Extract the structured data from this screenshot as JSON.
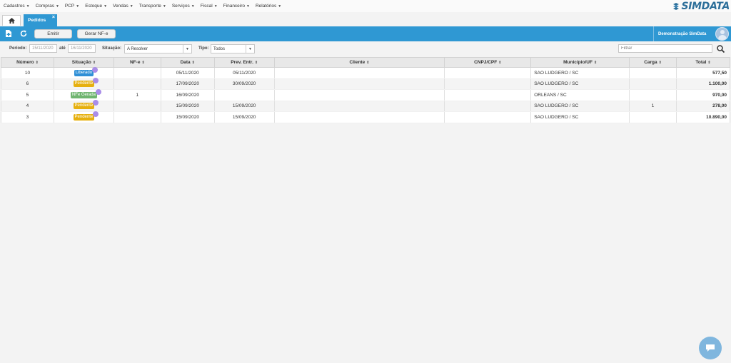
{
  "menu": [
    {
      "label": "Cadastros"
    },
    {
      "label": "Compras"
    },
    {
      "label": "PCP"
    },
    {
      "label": "Estoque"
    },
    {
      "label": "Vendas"
    },
    {
      "label": "Transporte"
    },
    {
      "label": "Serviços"
    },
    {
      "label": "Fiscal"
    },
    {
      "label": "Financeiro"
    },
    {
      "label": "Relatórios"
    }
  ],
  "logo_text": "SIMDATA",
  "tab": {
    "label": "Pedidos",
    "close": "×"
  },
  "toolbar": {
    "emitir": "Emitir",
    "gerar_nfe": "Gerar NF-e",
    "user": "Demonstração SimData"
  },
  "filters": {
    "periodo_label": "Período:",
    "date_from": "15/11/2020",
    "ate_label": "até",
    "date_to": "16/11/2020",
    "situacao_label": "Situação:",
    "situacao_value": "A Resolver",
    "tipo_label": "Tipo:",
    "tipo_value": "Todos",
    "filtrar_placeholder": "Filtrar"
  },
  "table": {
    "headers": [
      "Número",
      "Situação",
      "NF-e",
      "Data",
      "Prev. Entr.",
      "Cliente",
      "CNPJ/CPF",
      "Município/UF",
      "Carga",
      "Total"
    ],
    "rows": [
      {
        "numero": "10",
        "situacao": "Liberado",
        "badge_color": "#2f8fd6",
        "nfe": "",
        "data": "05/11/2020",
        "prev": "05/11/2020",
        "cliente": "",
        "cnpj": "",
        "municipio": "SAO LUDGERO / SC",
        "carga": "",
        "total": "577,50"
      },
      {
        "numero": "6",
        "situacao": "Pendente",
        "badge_color": "#e6b00f",
        "nfe": "",
        "data": "17/09/2020",
        "prev": "30/09/2020",
        "cliente": "",
        "cnpj": "",
        "municipio": "SAO LUDGERO / SC",
        "carga": "",
        "total": "1.100,00"
      },
      {
        "numero": "5",
        "situacao": "NFe Gerada",
        "badge_color": "#6fb56f",
        "nfe": "1",
        "data": "16/09/2020",
        "prev": "",
        "cliente": "",
        "cnpj": "",
        "municipio": "ORLEANS / SC",
        "carga": "",
        "total": "970,00"
      },
      {
        "numero": "4",
        "situacao": "Pendente",
        "badge_color": "#e6b00f",
        "nfe": "",
        "data": "15/09/2020",
        "prev": "15/09/2020",
        "cliente": "",
        "cnpj": "",
        "municipio": "SAO LUDGERO / SC",
        "carga": "1",
        "total": "278,00"
      },
      {
        "numero": "3",
        "situacao": "Pendente",
        "badge_color": "#e6b00f",
        "nfe": "",
        "data": "15/09/2020",
        "prev": "15/09/2020",
        "cliente": "",
        "cnpj": "",
        "municipio": "SAO LUDGERO / SC",
        "carga": "",
        "total": "10.890,00"
      }
    ]
  },
  "colors": {
    "accent": "#2f98d3",
    "logo": "#2d6f9a"
  },
  "icons": [
    "home-icon",
    "new-document-icon",
    "refresh-icon",
    "search-icon",
    "chat-icon"
  ]
}
